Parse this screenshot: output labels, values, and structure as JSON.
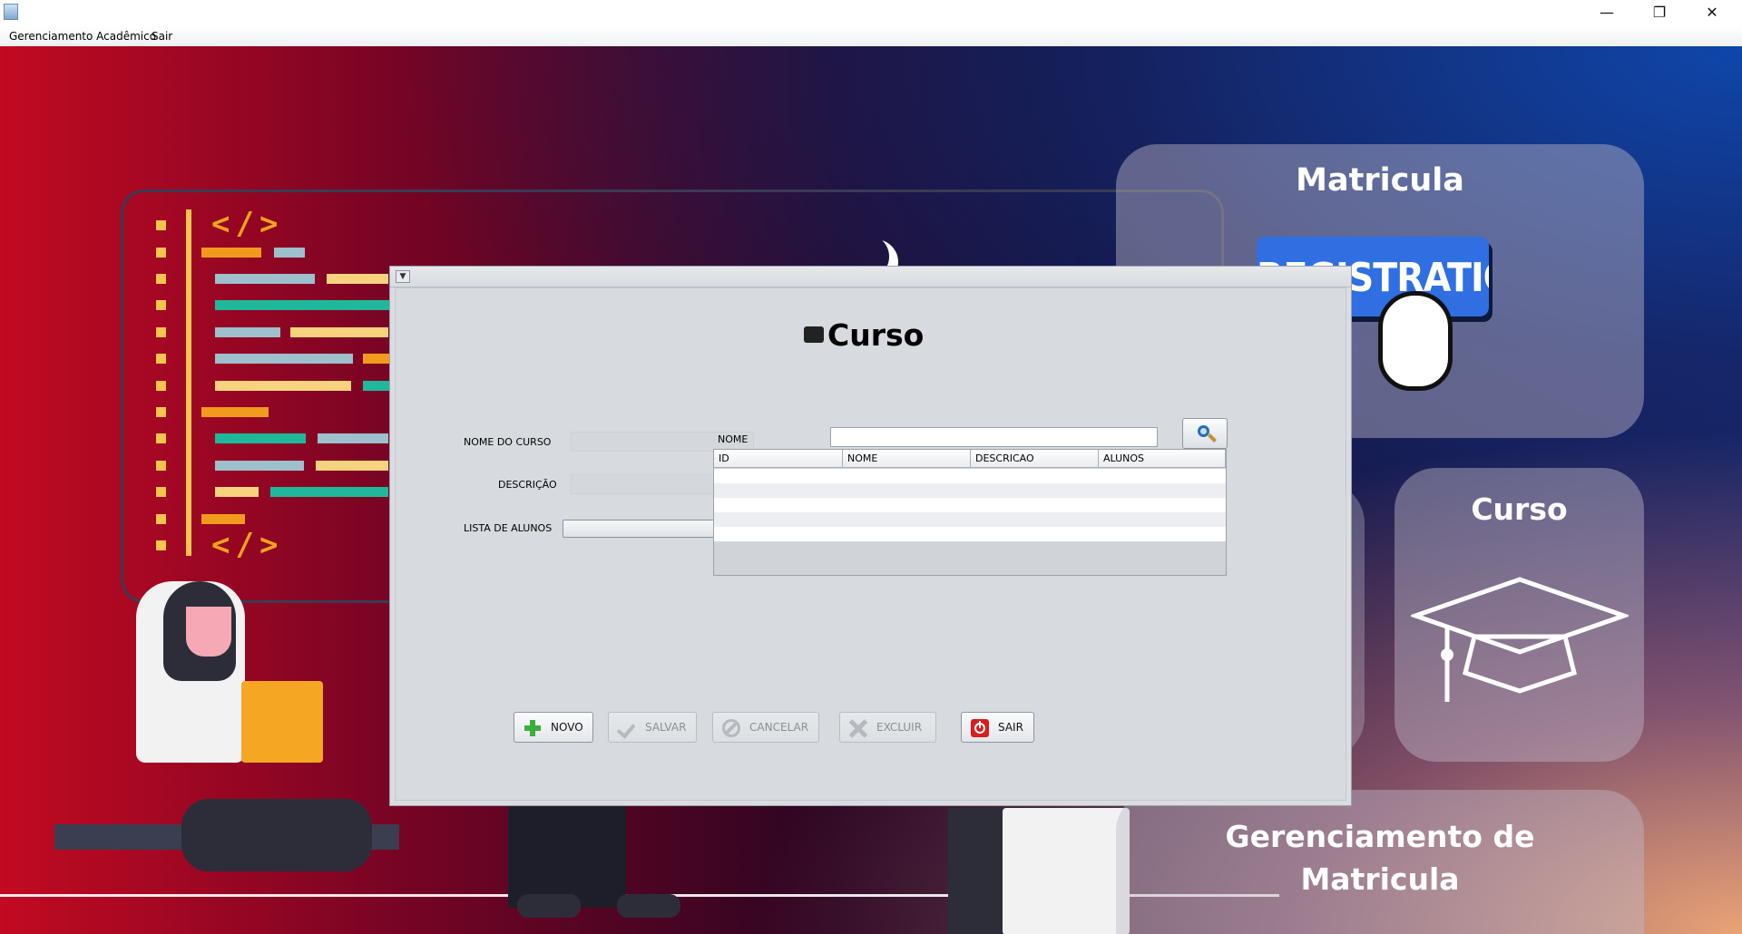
{
  "window": {
    "min": "—",
    "max": "❐",
    "close": "✕"
  },
  "menubar": {
    "items": [
      "Gerenciamento Acadêmico",
      "Sair"
    ]
  },
  "background": {
    "cards": {
      "matricula": {
        "title": "Matricula",
        "button": "REGISTRATION"
      },
      "curso": {
        "title": "Curso"
      },
      "gerenciamento": {
        "title_line1": "Gerenciamento de",
        "title_line2": "Matricula"
      }
    }
  },
  "form": {
    "title": "Curso",
    "labels": {
      "nome_do_curso": "NOME DO CURSO",
      "descricao": "DESCRIÇÃO",
      "lista_de_alunos": "LISTA DE ALUNOS",
      "nome": "NOME"
    },
    "fields": {
      "nome_do_curso": "",
      "descricao": "",
      "nome": ""
    },
    "table": {
      "columns": [
        "ID",
        "NOME",
        "DESCRICAO",
        "ALUNOS"
      ],
      "rows": []
    },
    "buttons": {
      "novo": "NOVO",
      "salvar": "SALVAR",
      "cancelar": "CANCELAR",
      "excluir": "EXCLUIR",
      "sair": "SAIR"
    }
  },
  "colors": {
    "accent": "#2f6fe2",
    "danger": "#d81e1e",
    "ok": "#3cae3a"
  }
}
